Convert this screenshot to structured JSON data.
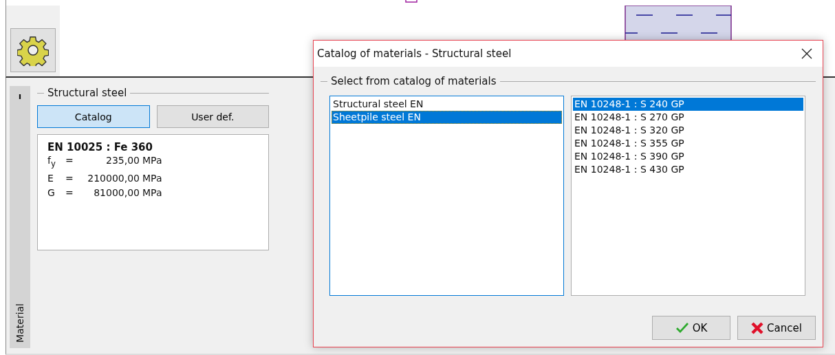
{
  "toolbar": {
    "settings_button": {
      "selected": false
    }
  },
  "side_tab": {
    "label": "Material",
    "marker": "ı"
  },
  "material_group": {
    "title": "Structural steel",
    "buttons": [
      {
        "label": "Catalog",
        "selected": true
      },
      {
        "label": "User def.",
        "selected": false
      }
    ],
    "info": {
      "title": "EN 10025 : Fe 360",
      "rows": [
        {
          "symbol": "f$_{y}$",
          "eq": "=",
          "value": "235,00",
          "unit": "MPa"
        },
        {
          "symbol": "E",
          "eq": "=",
          "value": "210000,00",
          "unit": "MPa"
        },
        {
          "symbol": "G",
          "eq": "=",
          "value": "81000,00",
          "unit": "MPa"
        }
      ]
    }
  },
  "dialog": {
    "title": "Catalog of materials - Structural steel",
    "group_title": "Select from catalog of materials",
    "catalogs": [
      {
        "label": "Structural steel EN",
        "selected": false
      },
      {
        "label": "Sheetpile steel EN",
        "selected": true
      }
    ],
    "materials": [
      {
        "label": "EN 10248-1 : S 240 GP",
        "selected": true
      },
      {
        "label": "EN 10248-1 : S 270 GP",
        "selected": false
      },
      {
        "label": "EN 10248-1 : S 320 GP",
        "selected": false
      },
      {
        "label": "EN 10248-1 : S 355 GP",
        "selected": false
      },
      {
        "label": "EN 10248-1 : S 390 GP",
        "selected": false
      },
      {
        "label": "EN 10248-1 : S 430 GP",
        "selected": false
      }
    ],
    "buttons": [
      {
        "kind": "ok",
        "label": "OK"
      },
      {
        "kind": "cancel",
        "label": "Cancel"
      }
    ]
  }
}
